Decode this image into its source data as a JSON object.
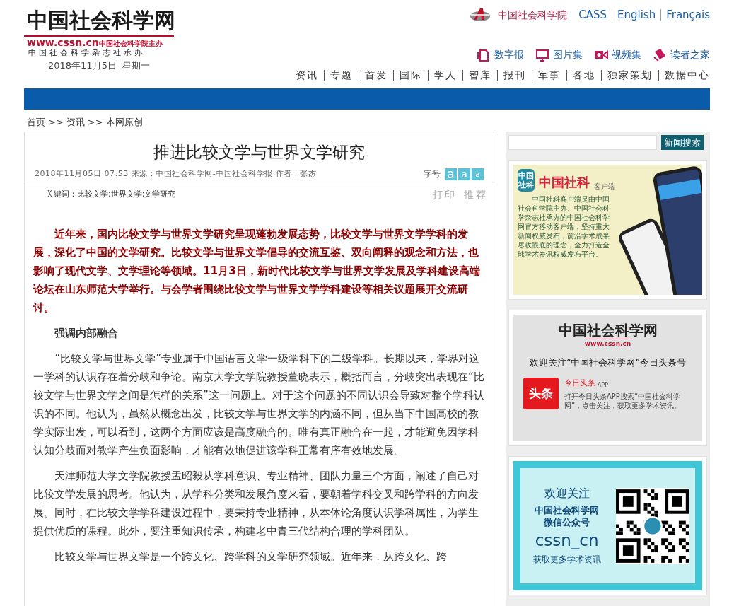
{
  "logo": {
    "title": "中国社会科学网",
    "url": "www.cssn.cn",
    "sponsor": "中国社会科学院主办",
    "publisher": "中国社会科学杂志社承办"
  },
  "date": "2018年11月5日  星期一",
  "top_links": [
    {
      "label": "中国社会科学院",
      "kind": "cass"
    },
    {
      "label": "CASS",
      "kind": "plain"
    },
    {
      "label": "English",
      "kind": "plain"
    },
    {
      "label": "Français",
      "kind": "plain"
    }
  ],
  "media_links": [
    {
      "label": "数字报",
      "kind": "paper"
    },
    {
      "label": "图片集",
      "kind": "monitor"
    },
    {
      "label": "视频集",
      "kind": "video"
    },
    {
      "label": "读者之家",
      "kind": "reader"
    }
  ],
  "nav": [
    "资讯",
    "专题",
    "首发",
    "国际",
    "学人",
    "智库",
    "报刊",
    "军事",
    "各地",
    "独家策划",
    "数据中心"
  ],
  "breadcrumb": [
    "首页",
    ">>",
    "资讯",
    ">>",
    "本网原创"
  ],
  "article": {
    "title": "推进比较文学与世界文学研究",
    "meta": "2018年11月05日 07:53 来源：中国社会科学网-中国社会科学报 作者：张杰",
    "font_label": "字号",
    "font_sizes": [
      "a",
      "a",
      "a"
    ],
    "keywords": "关键词：比较文学;世界文学;文学研究",
    "actions": [
      "打印",
      "推荐"
    ],
    "body": [
      {
        "kind": "lead",
        "text": "近年来，国内比较文学与世界文学研究呈现蓬勃发展态势，比较文学与世界文学学科的发展，深化了中国的文学研究。比较文学与世界文学倡导的交流互鉴、双向阐释的观念和方法，也影响了现代文学、文学理论等领域。11月3日，新时代比较文学与世界文学发展及学科建设高端论坛在山东师范大学举行。与会学者围绕比较文学与世界文学学科建设等相关议题展开交流研讨。"
      },
      {
        "kind": "heading",
        "text": "强调内部融合"
      },
      {
        "kind": "text",
        "text": "“比较文学与世界文学”专业属于中国语言文学一级学科下的二级学科。长期以来，学界对这一学科的认识存在着分歧和争论。南京大学文学院教授董晓表示，概括而言，分歧突出表现在“比较文学与世界文学之间是怎样的关系”这一问题上。对于这个问题的不同认识会导致对整个学科认识的不同。他认为，虽然从概念出发，比较文学与世界文学的内涵不同，但从当下中国高校的教学实际出发，可以看到，这两个方面应该是高度融合的。唯有真正融合在一起，才能避免因学科认知分歧而对教学产生负面影响，才能有效地促进该学科正常有序有效地发展。"
      },
      {
        "kind": "text",
        "text": "天津师范大学文学院教授孟昭毅从学科意识、专业精神、团队力量三个方面，阐述了自己对比较文学发展的思考。他认为，从学科分类和发展角度来看，要朝着学科交叉和跨学科的方向发展。同时，在比较文学学科建设过程中，要秉持专业精神，从本体论角度认识学科属性，为学生提供优质的课程。此外，要注重知识传承，构建老中青三代结构合理的学科团队。"
      },
      {
        "kind": "text",
        "text": "比较文学与世界文学是一个跨文化、跨学科的文学研究领域。近年来，从跨文化、跨"
      }
    ]
  },
  "sidebar": {
    "search_button": "新闻搜索",
    "app_banner": {
      "icon_text": "中国社科",
      "title": "中国社科",
      "subtitle": "客户端",
      "description": "中国社科客户端是由中国社会科学院主办、中国社会科学杂志社承办的中国社会科学网官方移动客户端，坚持重大新闻权威发布，前沿学术成果尽收眼底的理念，全力打造全球学术资讯权威发布平台。"
    },
    "toutiao_banner": {
      "logo_title": "中国社会科学网",
      "logo_url": "www.cssn.cn",
      "headline": "欢迎关注“中国社会科学网”今日头条号",
      "icon_text": "头条",
      "app_name": "今日头条",
      "app_tag": "APP",
      "description": "打开今日头条APP搜索“中国社会科学网”，点击关注，获取更多学术资讯。"
    },
    "wechat_banner": {
      "welcome": "欢迎关注",
      "name": "中国社会科学网",
      "account": "微信公众号",
      "id": "cssn_cn",
      "footer": "获取更多学术资讯"
    }
  }
}
